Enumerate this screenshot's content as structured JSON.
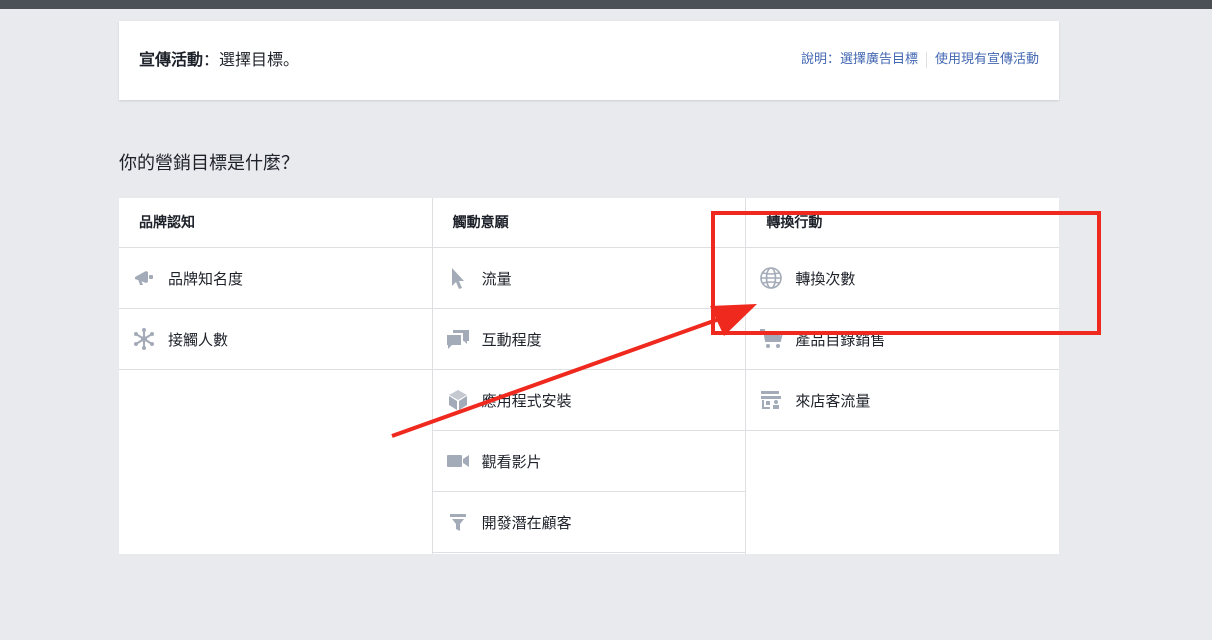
{
  "header": {
    "campaign_label": "宣傳活動",
    "prompt": "：選擇目標。",
    "links": [
      "說明：選擇廣告目標",
      "使用現有宣傳活動"
    ]
  },
  "section_title": "你的營銷目標是什麼？",
  "columns": [
    {
      "title": "品牌認知",
      "items": [
        {
          "label": "品牌知名度",
          "icon": "megaphone-icon"
        },
        {
          "label": "接觸人數",
          "icon": "network-icon"
        }
      ]
    },
    {
      "title": "觸動意願",
      "items": [
        {
          "label": "流量",
          "icon": "cursor-icon"
        },
        {
          "label": "互動程度",
          "icon": "chat-bubbles-icon"
        },
        {
          "label": "應用程式安裝",
          "icon": "box-icon"
        },
        {
          "label": "觀看影片",
          "icon": "video-camera-icon"
        },
        {
          "label": "開發潛在顧客",
          "icon": "funnel-icon"
        }
      ]
    },
    {
      "title": "轉換行動",
      "items": [
        {
          "label": "轉換次數",
          "icon": "globe-icon"
        },
        {
          "label": "產品目錄銷售",
          "icon": "cart-icon"
        },
        {
          "label": "來店客流量",
          "icon": "store-icon"
        }
      ]
    }
  ],
  "colors": {
    "annotation": "#f0291e",
    "link": "#4267b2",
    "icon": "#a4abb8"
  }
}
